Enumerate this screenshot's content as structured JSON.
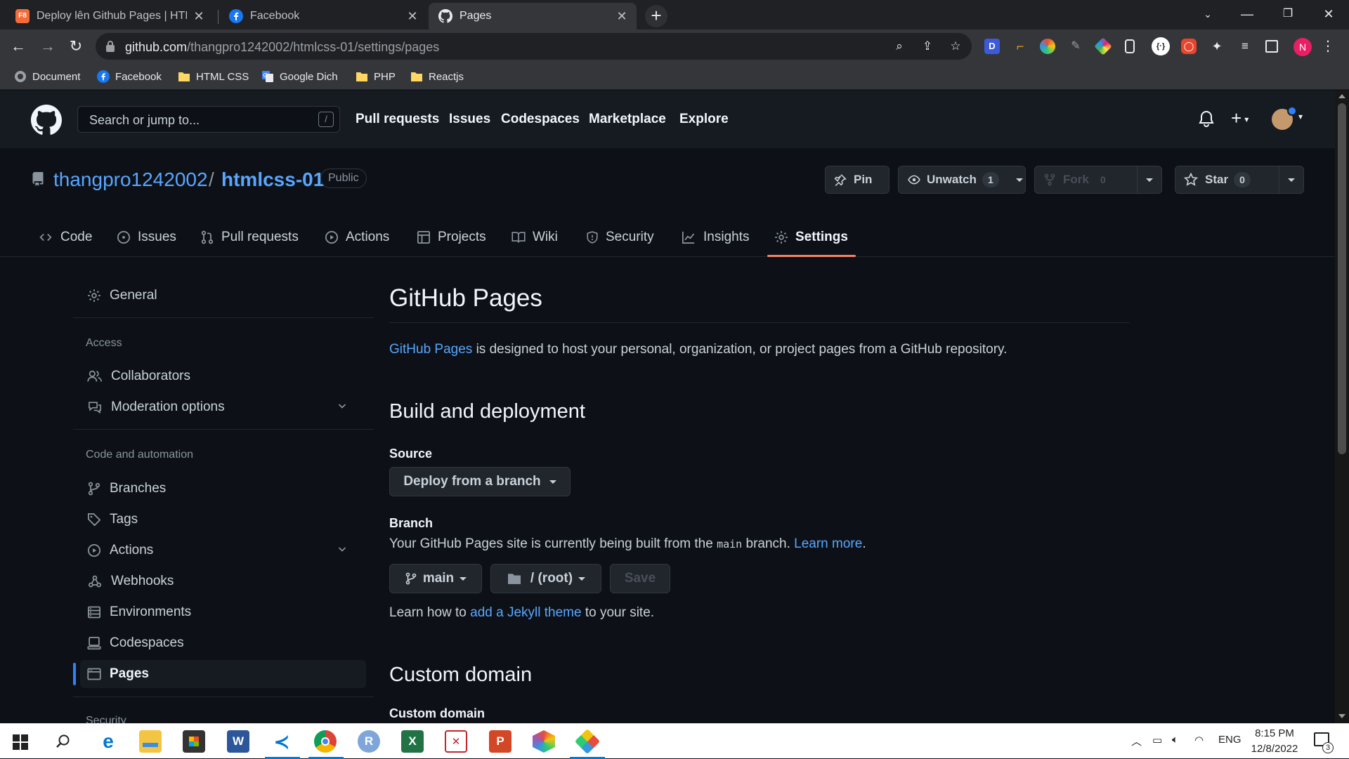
{
  "browser": {
    "tabs": [
      {
        "title": "Deploy lên Github Pages | HTML",
        "favicon": "f8-icon"
      },
      {
        "title": "Facebook",
        "favicon": "facebook-icon"
      },
      {
        "title": "Pages",
        "favicon": "github-icon"
      }
    ],
    "url_domain": "github.com",
    "url_path": "/thangpro1242002/htmlcss-01/settings/pages",
    "profile_initial": "N",
    "bookmarks": [
      "Document",
      "Facebook",
      "HTML CSS",
      "Google Dich",
      "PHP",
      "Reactjs"
    ]
  },
  "gh_header": {
    "search_placeholder": "Search or jump to...",
    "search_shortcut": "/",
    "nav": [
      "Pull requests",
      "Issues",
      "Codespaces",
      "Marketplace",
      "Explore"
    ]
  },
  "repo": {
    "owner": "thangpro1242002",
    "separator": "/",
    "name": "htmlcss-01",
    "visibility": "Public",
    "pin_label": "Pin",
    "watch_label": "Unwatch",
    "watch_count": "1",
    "fork_label": "Fork",
    "fork_count": "0",
    "star_label": "Star",
    "star_count": "0",
    "tabs": [
      "Code",
      "Issues",
      "Pull requests",
      "Actions",
      "Projects",
      "Wiki",
      "Security",
      "Insights",
      "Settings"
    ],
    "active_tab": "Settings"
  },
  "sidebar": {
    "general": "General",
    "access_heading": "Access",
    "collaborators": "Collaborators",
    "moderation": "Moderation options",
    "code_heading": "Code and automation",
    "branches": "Branches",
    "tags": "Tags",
    "actions": "Actions",
    "webhooks": "Webhooks",
    "environments": "Environments",
    "codespaces": "Codespaces",
    "pages": "Pages",
    "security_heading": "Security"
  },
  "main": {
    "title": "GitHub Pages",
    "intro_link": "GitHub Pages",
    "intro_text": " is designed to host your personal, organization, or project pages from a GitHub repository.",
    "build_heading": "Build and deployment",
    "source_label": "Source",
    "source_value": "Deploy from a branch",
    "branch_label": "Branch",
    "branch_text_pre": "Your GitHub Pages site is currently being built from the ",
    "branch_code": "main",
    "branch_text_post": " branch. ",
    "learn_more": "Learn more",
    "period": ".",
    "branch_select": "main",
    "folder_select": "/ (root)",
    "save_label": "Save",
    "jekyll_pre": "Learn how to ",
    "jekyll_link": "add a Jekyll theme",
    "jekyll_post": " to your site.",
    "custom_domain_heading": "Custom domain",
    "custom_domain_label": "Custom domain"
  },
  "taskbar": {
    "language": "ENG",
    "time": "8:15 PM",
    "date": "12/8/2022",
    "notifications": "3"
  },
  "colors": {
    "bg": "#0d1117",
    "header_bg": "#161b22",
    "link": "#58a6ff",
    "active_tab_underline": "#f78166",
    "selected_indicator": "#2f81f7"
  }
}
